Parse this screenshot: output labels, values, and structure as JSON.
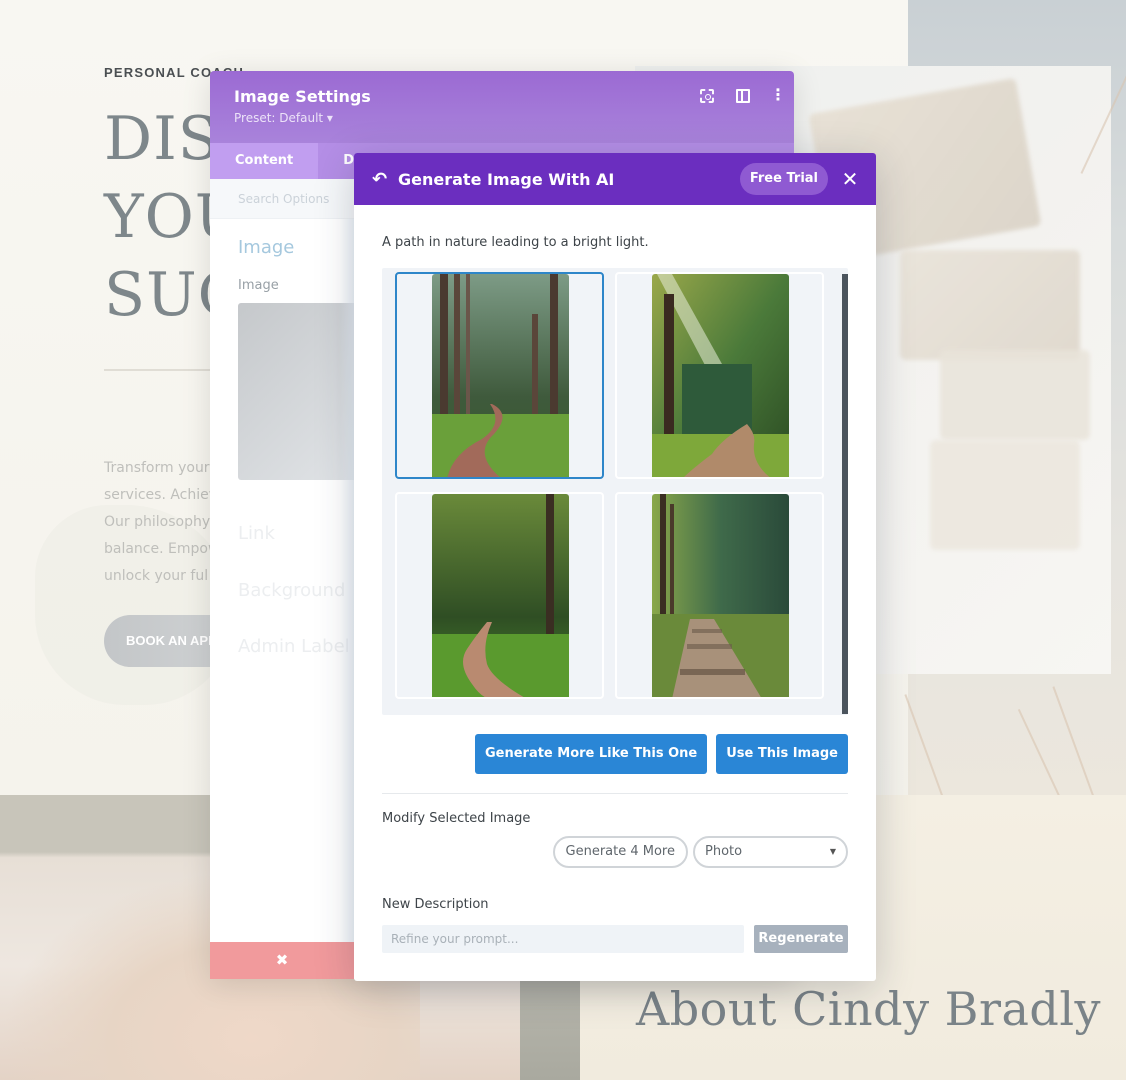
{
  "website": {
    "eyebrow": "PERSONAL COACH",
    "hero_lines": [
      "DISC",
      "YOU",
      "SUC"
    ],
    "hero_text": [
      "Transform your",
      "services. Achiev",
      "Our philosophy",
      "balance. Empow",
      "unlock your ful"
    ],
    "cta_label": "BOOK AN APPOINTMENT",
    "about_title": "About Cindy Bradly"
  },
  "settings_panel": {
    "title": "Image Settings",
    "preset": "Preset: Default ▾",
    "header_icons": [
      "focus-icon",
      "split-view-icon",
      "more-options-icon"
    ],
    "tabs": [
      {
        "label": "Content",
        "active": true
      },
      {
        "label": "Design",
        "active": false
      }
    ],
    "search_placeholder": "Search Options",
    "section_title": "Image",
    "field_label": "Image",
    "collapsed_sections": [
      "Link",
      "Background",
      "Admin Label"
    ],
    "footer_cancel": "✖"
  },
  "ai_modal": {
    "title": "Generate Image With AI",
    "free_trial": "Free Trial",
    "close": "✕",
    "back": "↶",
    "prompt": "A path in nature leading to a bright light.",
    "images": [
      {
        "alt": "Forest path with tall pines",
        "selected": true
      },
      {
        "alt": "Forest path with sunbeam",
        "selected": false
      },
      {
        "alt": "Winding dirt path through green woods",
        "selected": false
      },
      {
        "alt": "Sunlit forest trail",
        "selected": false
      }
    ],
    "buttons": {
      "generate_more_like": "Generate More Like This One",
      "use_image": "Use This Image"
    },
    "modify_label": "Modify Selected Image",
    "generate_4_more": "Generate 4 More",
    "style_select": {
      "value": "Photo",
      "caret": "▼"
    },
    "new_description_label": "New Description",
    "refine_placeholder": "Refine your prompt...",
    "refine_value": "",
    "regenerate": "Regenerate"
  },
  "colors": {
    "modal_header": "#6b2ebf",
    "settings_header": "#9b6ad3",
    "primary_button": "#2a86d6",
    "selected_border": "#2e86c9",
    "cancel_red": "#f19a9c"
  }
}
